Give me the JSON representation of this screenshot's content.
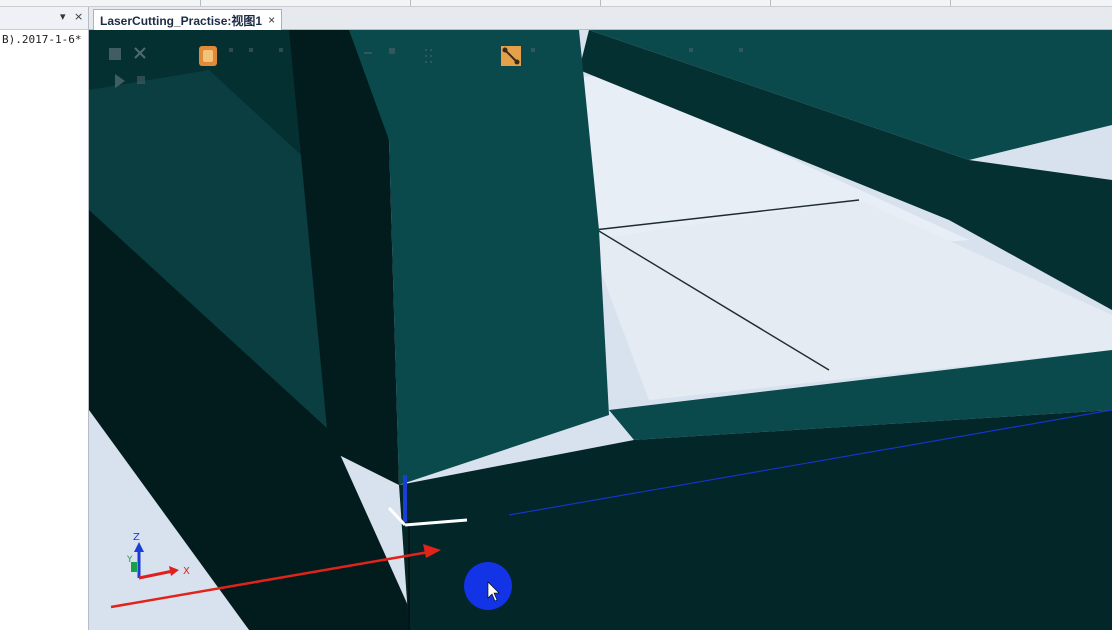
{
  "left_panel": {
    "pin_glyph": "▾",
    "close_glyph": "×",
    "item_text": "B).2017-1-6*"
  },
  "document_tab": {
    "title": "LaserCutting_Practise:视图1",
    "close_glyph": "×"
  },
  "axis_triad": {
    "z_label": "Z",
    "y_label": "Y",
    "x_label": "X"
  },
  "colors": {
    "beam_top": "#0b4a4c",
    "beam_side": "#053032",
    "beam_shadow": "#021c1e",
    "floor": "#d8e2ee",
    "floor_light": "#e8eef5",
    "arrow": "#e2231a",
    "cursor_circle": "#1233e6",
    "axis_z": "#1a3fd6",
    "axis_x": "#e02020",
    "axis_y": "#19a14a"
  },
  "icons": [
    "select-icon",
    "transform-icon",
    "render-icon",
    "snap-point-icon",
    "edit-line-icon",
    "play-icon"
  ]
}
